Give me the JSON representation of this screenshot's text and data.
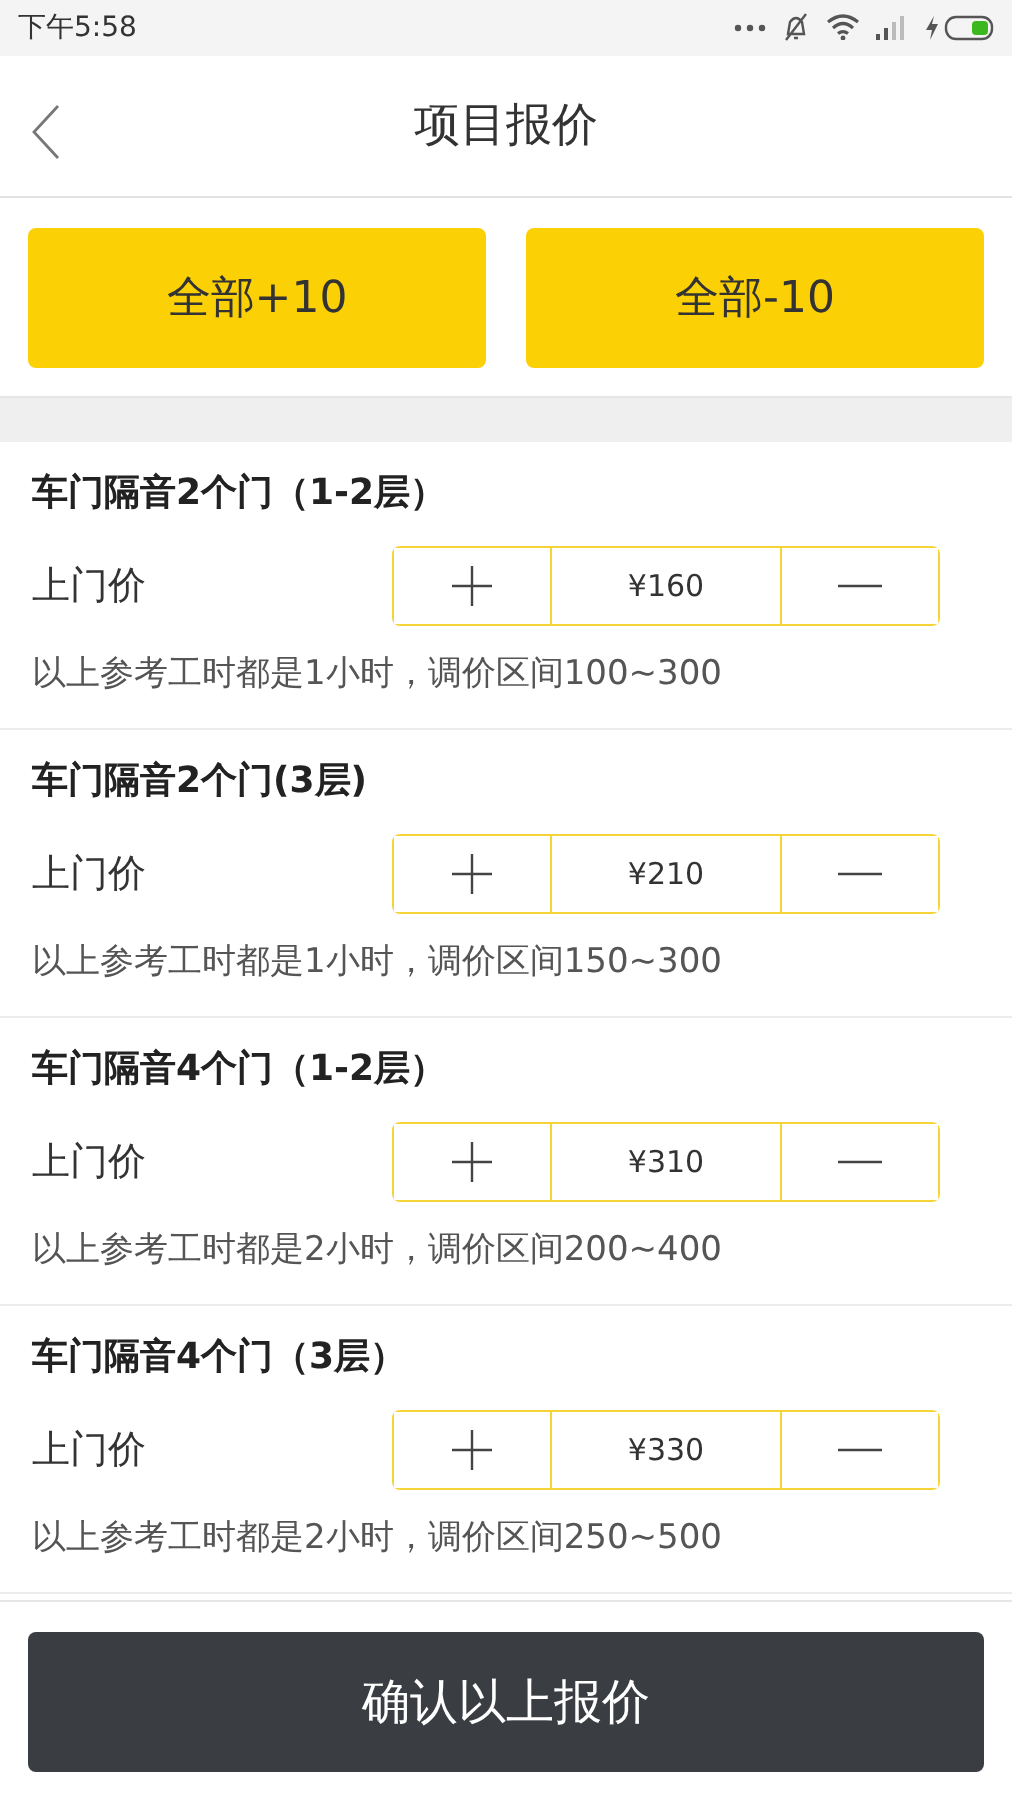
{
  "status_bar": {
    "time": "下午5:58"
  },
  "header": {
    "title": "项目报价"
  },
  "bulk_buttons": [
    {
      "label": "全部+10"
    },
    {
      "label": "全部-10"
    }
  ],
  "items": [
    {
      "title": "车门隔音2个门（1-2层）",
      "price_label": "上门价",
      "price": "¥160",
      "note": "以上参考工时都是1小时，调价区间100~300"
    },
    {
      "title": "车门隔音2个门(3层)",
      "price_label": "上门价",
      "price": "¥210",
      "note": "以上参考工时都是1小时，调价区间150~300"
    },
    {
      "title": "车门隔音4个门（1-2层）",
      "price_label": "上门价",
      "price": "¥310",
      "note": "以上参考工时都是2小时，调价区间200~400"
    },
    {
      "title": "车门隔音4个门（3层）",
      "price_label": "上门价",
      "price": "¥330",
      "note": "以上参考工时都是2小时，调价区间250~500"
    }
  ],
  "confirm_button": {
    "label": "确认以上报价"
  }
}
